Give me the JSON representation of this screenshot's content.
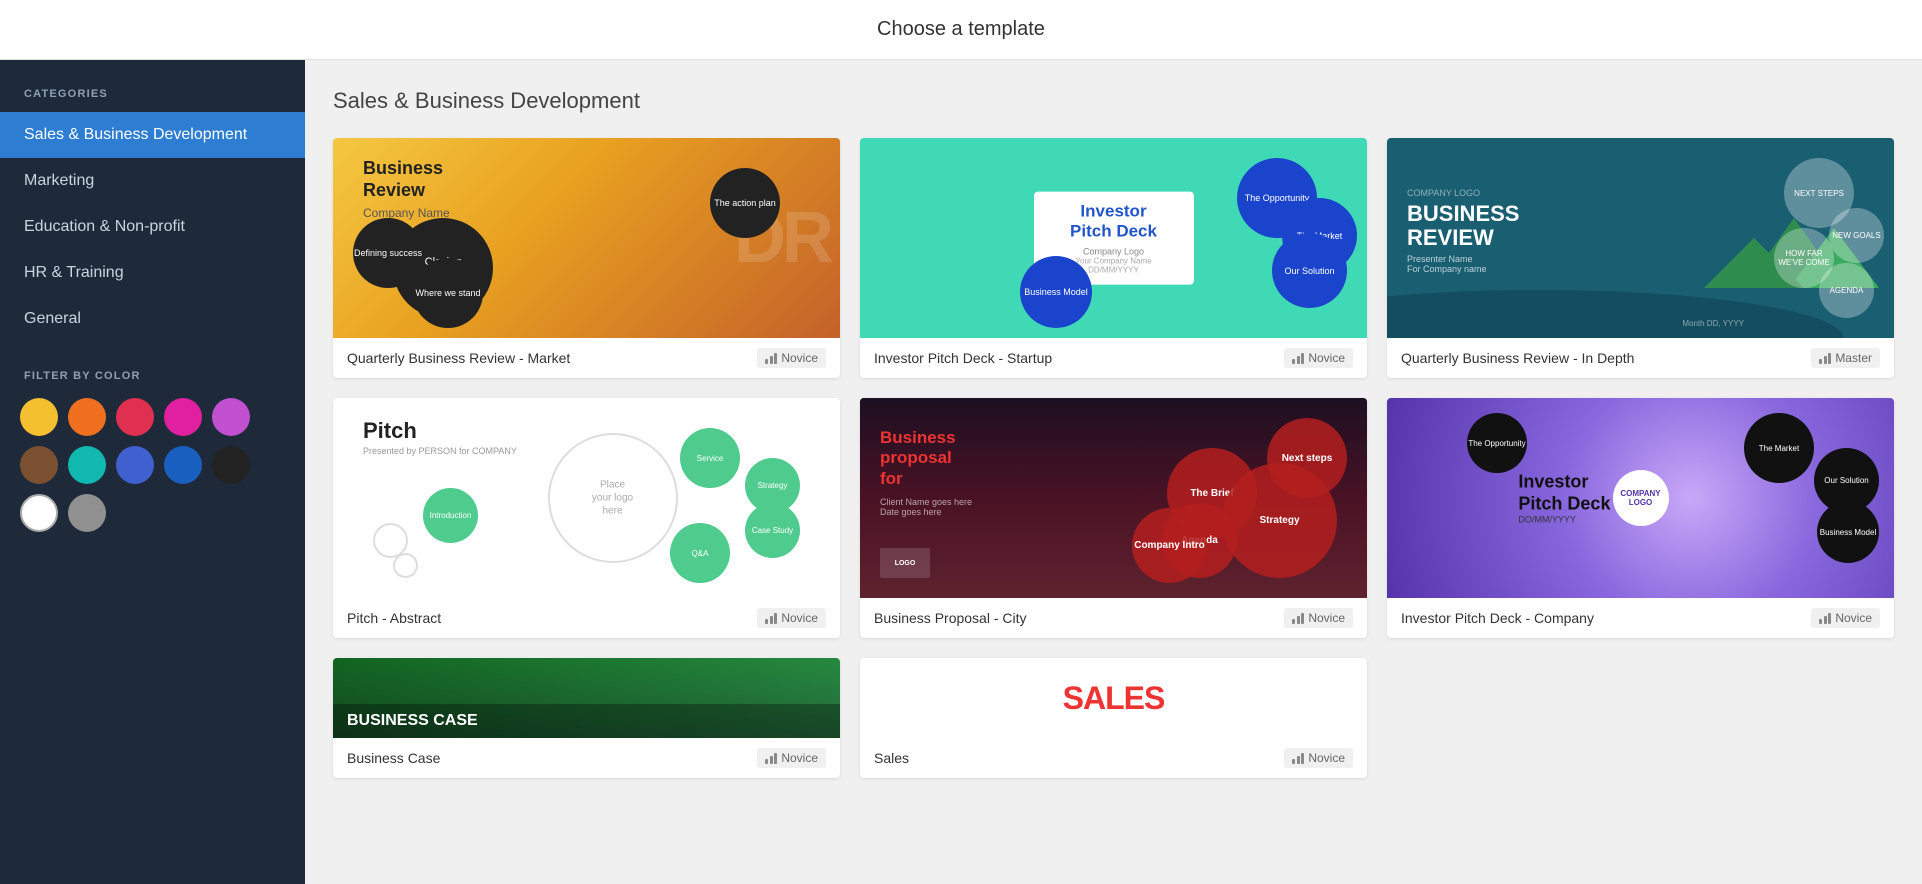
{
  "header": {
    "title": "Choose a template"
  },
  "sidebar": {
    "categories_label": "CATEGORIES",
    "categories": [
      {
        "id": "sales",
        "label": "Sales & Business Development",
        "active": true
      },
      {
        "id": "marketing",
        "label": "Marketing",
        "active": false
      },
      {
        "id": "education",
        "label": "Education & Non-profit",
        "active": false
      },
      {
        "id": "hr",
        "label": "HR & Training",
        "active": false
      },
      {
        "id": "general",
        "label": "General",
        "active": false
      }
    ],
    "filter_label": "FILTER BY COLOR",
    "colors": [
      "#f5c030",
      "#f07020",
      "#e03050",
      "#e020a0",
      "#c050d0",
      "#7a5030",
      "#10b8b0",
      "#4060d0",
      "#1a60c0",
      "#222222",
      "#ffffff",
      "#909090"
    ]
  },
  "content": {
    "section_title": "Sales & Business Development",
    "templates": [
      {
        "id": "qbr-market",
        "name": "Quarterly Business Review - Market",
        "level": "Novice"
      },
      {
        "id": "investor-startup",
        "name": "Investor Pitch Deck - Startup",
        "level": "Novice"
      },
      {
        "id": "qbr-depth",
        "name": "Quarterly Business Review - In Depth",
        "level": "Master"
      },
      {
        "id": "pitch-abstract",
        "name": "Pitch - Abstract",
        "level": "Novice"
      },
      {
        "id": "biz-proposal-city",
        "name": "Business Proposal - City",
        "level": "Novice"
      },
      {
        "id": "investor-company",
        "name": "Investor Pitch Deck - Company",
        "level": "Novice"
      },
      {
        "id": "biz-case",
        "name": "Business Case",
        "level": "Novice"
      },
      {
        "id": "sales",
        "name": "Sales",
        "level": "Novice"
      }
    ]
  }
}
